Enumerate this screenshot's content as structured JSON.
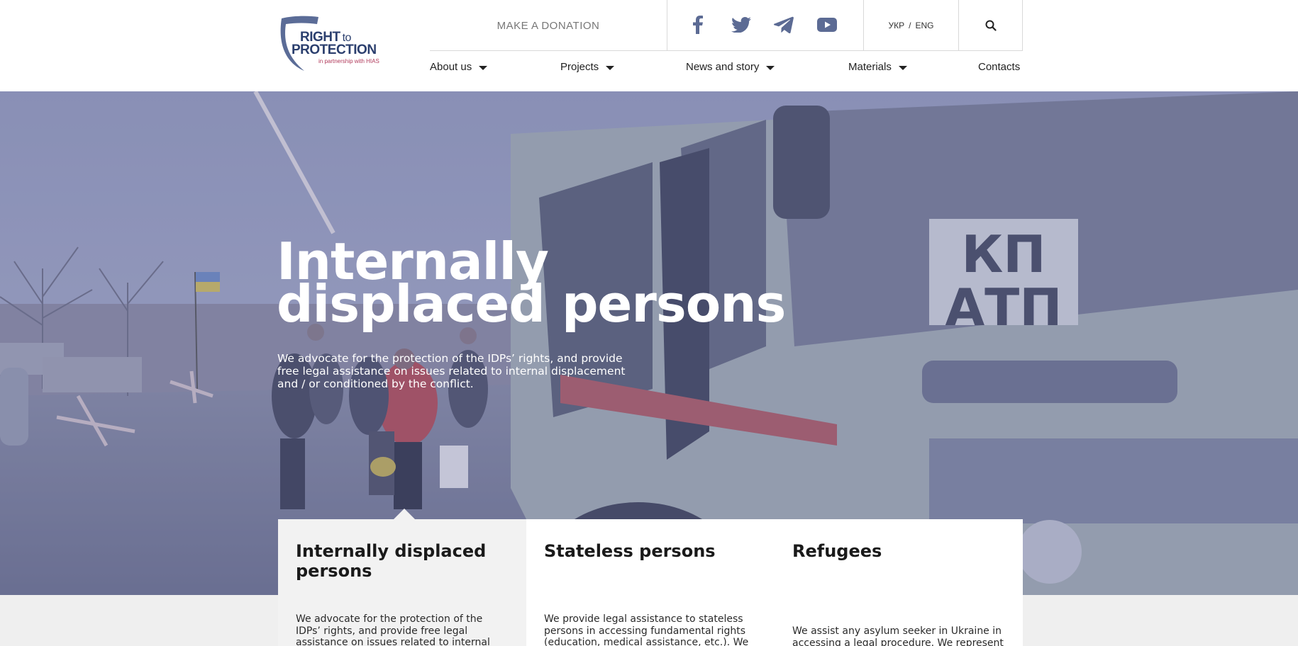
{
  "brand": {
    "logo_line1": "RIGHT",
    "logo_line1_small": "to",
    "logo_line2": "PROTECTION",
    "logo_partner": "in partnership with HIAS"
  },
  "header": {
    "donate_label": "MAKE A DONATION",
    "socials": [
      {
        "icon": "facebook-icon"
      },
      {
        "icon": "twitter-icon"
      },
      {
        "icon": "telegram-icon"
      },
      {
        "icon": "youtube-icon"
      }
    ],
    "lang": {
      "ukr": "УКР",
      "sep": "/",
      "eng": "ENG"
    },
    "search_icon": "search-icon"
  },
  "nav": {
    "items": [
      {
        "label": "About us",
        "dropdown": true
      },
      {
        "label": "Projects",
        "dropdown": true
      },
      {
        "label": "News and story",
        "dropdown": true
      },
      {
        "label": "Materials",
        "dropdown": true
      },
      {
        "label": "Contacts",
        "dropdown": false
      }
    ]
  },
  "hero": {
    "title_line1": "Internally",
    "title_line2": "displaced persons",
    "description": "We advocate for the protection of the IDPs’ rights, and provide free legal assistance on issues related to internal displacement and / or conditioned by the conflict.",
    "bus_sign_top": "КП",
    "bus_sign_bottom": "АТП"
  },
  "cards": [
    {
      "title": "Internally displaced persons",
      "text": "We advocate for the protection of the IDPs’ rights, and provide free legal assistance on issues related to internal",
      "active": true
    },
    {
      "title": "Stateless persons",
      "text": "We provide legal assistance to stateless persons in accessing fundamental rights (education, medical assistance, etc.). We",
      "active": false
    },
    {
      "title": "Refugees",
      "text": "We assist any asylum seeker in Ukraine in accessing a legal procedure. We represent",
      "active": false
    }
  ],
  "colors": {
    "brand_navy": "#2b3f6e",
    "brand_accent": "#b03a5b",
    "overlay": "#5c6496",
    "social_icon": "#5c6b94"
  }
}
